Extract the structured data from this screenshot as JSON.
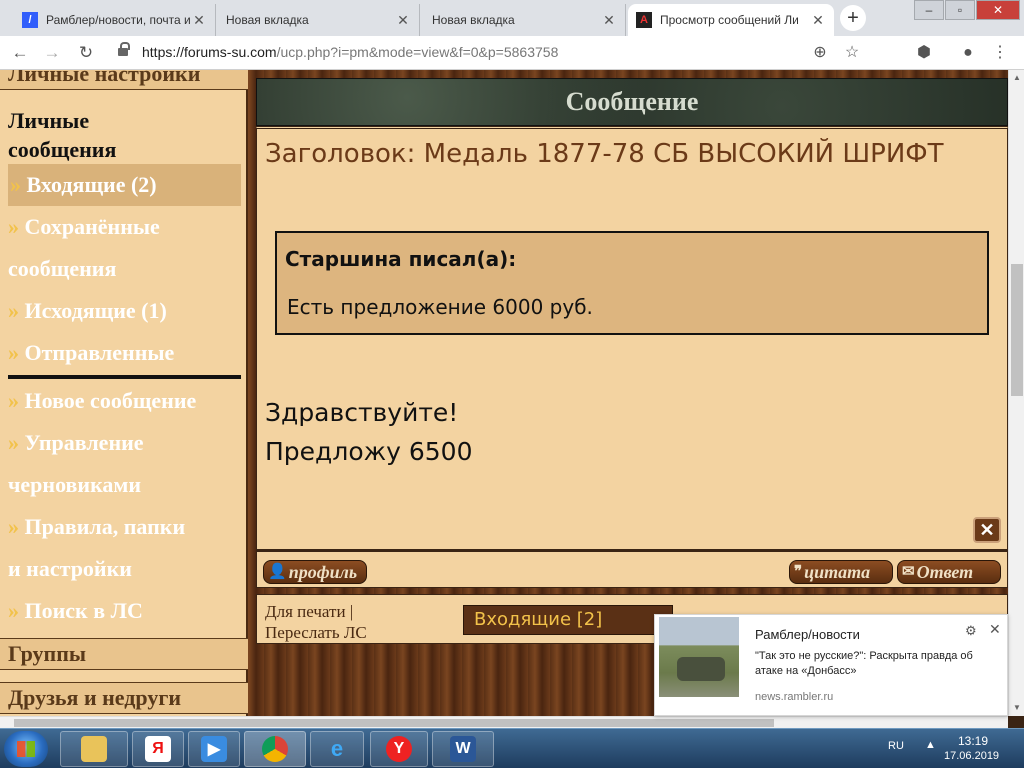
{
  "browser": {
    "tabs": [
      {
        "title": "Рамблер/новости, почта и",
        "active": false,
        "favicon": "rambler-icon"
      },
      {
        "title": "Новая вкладка",
        "active": false,
        "favicon": "newtab-icon"
      },
      {
        "title": "Новая вкладка",
        "active": false,
        "favicon": "newtab-icon"
      },
      {
        "title": "Просмотр сообщений Ли",
        "active": true,
        "favicon": "forum-icon"
      }
    ],
    "new_tab": "+",
    "url_host": "https://forums-su.com",
    "url_path": "/ucp.php?i=pm&mode=view&f=0&p=5863758"
  },
  "sidebar": {
    "top_heading": "Личные настройки",
    "section_title_line1": "Личные",
    "section_title_line2": "сообщения",
    "items": [
      {
        "label": "Входящие (2)",
        "selected": true
      },
      {
        "label": "Сохранённые",
        "continuation": "сообщения"
      },
      {
        "label": "Исходящие (1)"
      },
      {
        "label": "Отправленные"
      },
      {
        "label": "Новое сообщение"
      },
      {
        "label": "Управление",
        "continuation": "черновиками"
      },
      {
        "label": "Правила, папки",
        "continuation": "и настройки"
      },
      {
        "label": "Поиск в ЛС"
      }
    ],
    "arrow": "»",
    "groups_heading": "Группы",
    "friends_heading": "Друзья и недруги"
  },
  "message": {
    "header": "Сообщение",
    "subject": "Заголовок: Медаль 1877-78 СБ ВЫСОКИЙ ШРИФТ",
    "quote_author": "Старшина писал(а):",
    "quote_text": "Есть предложение 6000 руб.",
    "body_line1": "Здравствуйте!",
    "body_line2": "Предложу 6500",
    "delete_symbol": "✕"
  },
  "buttons": {
    "profile": "профиль",
    "quote": "цитата",
    "reply": "Ответ"
  },
  "footer": {
    "print": "Для печати",
    "separator": "|",
    "forward": "Переслать ЛС",
    "folder_select": "Входящие [2]"
  },
  "notification": {
    "source": "Рамблер/новости",
    "headline": "\"Так это не русские?\": Раскрыта правда об атаке на «Донбасс»",
    "site": "news.rambler.ru"
  },
  "taskbar": {
    "lang": "RU",
    "time": "13:19",
    "date": "17.06.2019"
  },
  "colors": {
    "panel_bg": "#f3d3a1",
    "accent_brown": "#6b3a18",
    "arrow_gold": "#f2c24a"
  }
}
